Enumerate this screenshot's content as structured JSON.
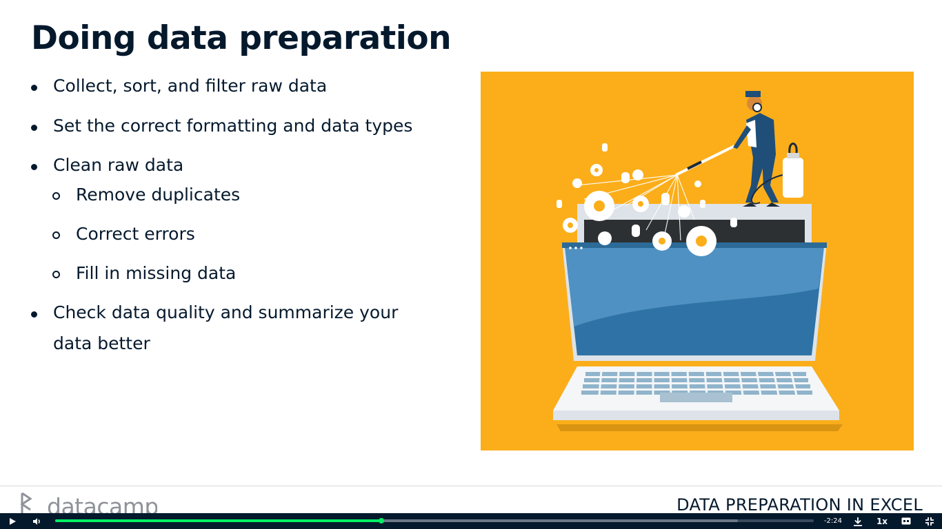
{
  "slide": {
    "title": "Doing data preparation",
    "bullets": [
      {
        "text": "Collect, sort, and filter raw data"
      },
      {
        "text": "Set the correct formatting and data types"
      },
      {
        "text": "Clean raw data"
      },
      {
        "text": "Check data quality and summarize your"
      },
      {
        "text": "data better"
      }
    ],
    "sub_bullets": [
      {
        "text": "Remove duplicates"
      },
      {
        "text": "Correct errors"
      },
      {
        "text": "Fill in missing data"
      }
    ],
    "illustration": {
      "background": "#fbae1a",
      "subject": "technician spraying bugs out of a laptop"
    }
  },
  "footer": {
    "logo_text": "datacamp",
    "course_title": "DATA PREPARATION IN EXCEL"
  },
  "player": {
    "time_remaining": "-2:24",
    "speed": "1x",
    "progress": 0.43,
    "buffered": 0.9,
    "accent": "#03ef62",
    "bar_color": "#05192d",
    "icons": [
      "play-icon",
      "volume-icon",
      "download-icon",
      "captions-icon",
      "exit-fullscreen-icon"
    ]
  }
}
